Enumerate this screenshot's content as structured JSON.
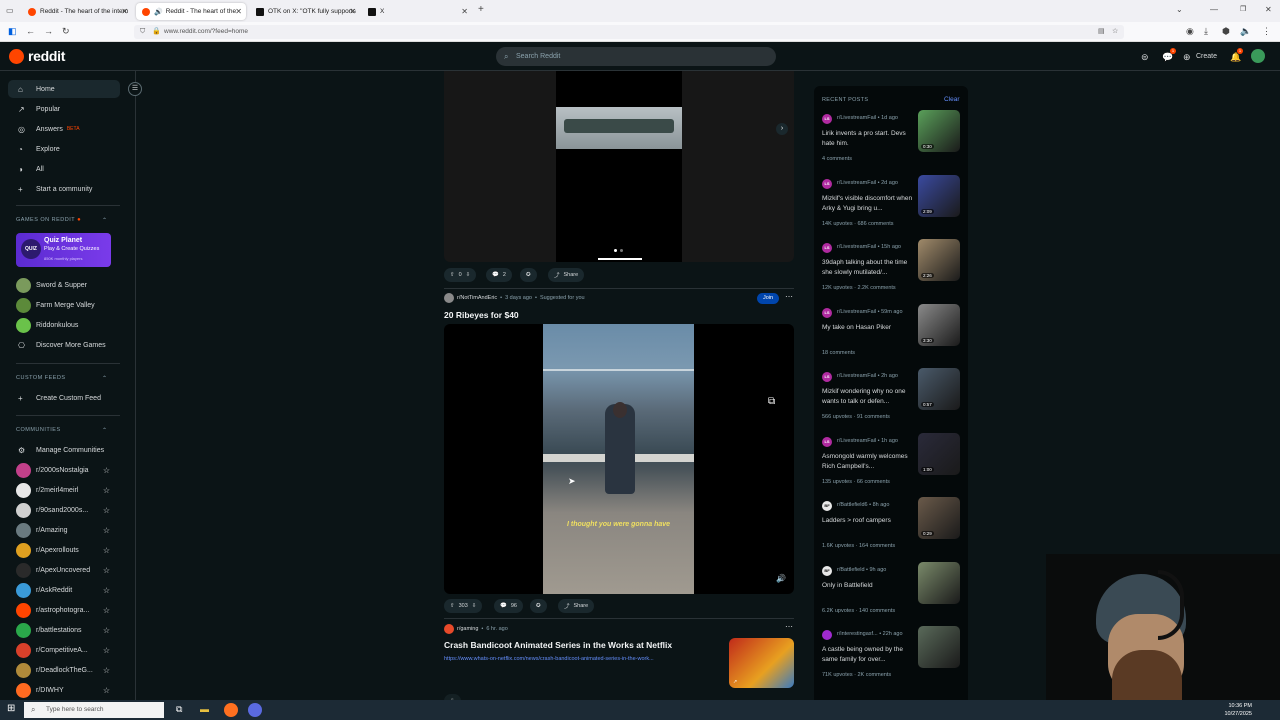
{
  "browser": {
    "tabs": [
      {
        "title": "Reddit - The heart of the intern",
        "color": "#ff4500",
        "active": false
      },
      {
        "title": "Reddit - The heart of the in",
        "color": "#ff4500",
        "active": true
      },
      {
        "title": "OTK on X: \"OTK fully supports a",
        "color": "#111111",
        "active": false
      },
      {
        "title": "X",
        "color": "#111111",
        "active": false
      }
    ],
    "new_tab": "+",
    "url": "www.reddit.com/?feed=home"
  },
  "header": {
    "logo": "reddit",
    "search_placeholder": "Search Reddit",
    "create_label": "Create",
    "chat_badge": "1",
    "notif_badge": "1"
  },
  "sidebar": {
    "nav": [
      {
        "label": "Home",
        "icon": "home-icon",
        "glyph": "⌂",
        "active": true
      },
      {
        "label": "Popular",
        "icon": "popular-icon",
        "glyph": "↗"
      },
      {
        "label": "Answers",
        "icon": "answers-icon",
        "glyph": "◎",
        "badge": "BETA"
      },
      {
        "label": "Explore",
        "icon": "explore-icon",
        "glyph": "◔"
      },
      {
        "label": "All",
        "icon": "all-icon",
        "glyph": "◑"
      },
      {
        "label": "Start a community",
        "icon": "plus-icon",
        "glyph": "+"
      }
    ],
    "games_header": "GAMES ON REDDIT",
    "quiz": {
      "title": "Quiz Planet",
      "subtitle": "Play & Create Quizzes",
      "players": "850K monthly players",
      "logo": "QUIZ"
    },
    "games": [
      {
        "label": "Sword & Supper",
        "color": "#7a9a5c"
      },
      {
        "label": "Farm Merge Valley",
        "color": "#5c8a3a"
      },
      {
        "label": "Riddonkulous",
        "color": "#6ac24a"
      },
      {
        "label": "Discover More Games",
        "color": "#3a4a50"
      }
    ],
    "custom_feeds_header": "CUSTOM FEEDS",
    "create_custom_feed": "Create Custom Feed",
    "communities_header": "COMMUNITIES",
    "manage_communities": "Manage Communities",
    "communities": [
      {
        "label": "r/2000sNostalgia",
        "color": "#c2408a"
      },
      {
        "label": "r/2meirl4meirl",
        "color": "#e8e8e8"
      },
      {
        "label": "r/90sand2000s...",
        "color": "#d0d0d0"
      },
      {
        "label": "r/Amazing",
        "color": "#6a7a80"
      },
      {
        "label": "r/Apexrollouts",
        "color": "#e0a020"
      },
      {
        "label": "r/ApexUncovered",
        "color": "#2a2a2a"
      },
      {
        "label": "r/AskReddit",
        "color": "#3a9ad8"
      },
      {
        "label": "r/astrophotogra...",
        "color": "#ff4500"
      },
      {
        "label": "r/battlestations",
        "color": "#2aa84a"
      },
      {
        "label": "r/CompetitiveA...",
        "color": "#d8402a"
      },
      {
        "label": "r/DeadlockTheG...",
        "color": "#b08a3a"
      },
      {
        "label": "r/DIWHY",
        "color": "#ff6a20"
      }
    ]
  },
  "feed": {
    "post1": {
      "votes": "0",
      "comments": "2",
      "share": "Share"
    },
    "post2": {
      "subreddit": "r/NotTimAndEric",
      "time": "3 days ago",
      "suggested": "Suggested for you",
      "join": "Join",
      "title": "20 Ribeyes for $40",
      "caption": "I thought you were gonna have",
      "votes": "303",
      "comments": "96",
      "share": "Share"
    },
    "post3": {
      "subreddit": "r/gaming",
      "time": "6 hr. ago",
      "title": "Crash Bandicoot Animated Series in the Works at Netflix",
      "link": "https://www.whats-on-netflix.com/news/crash-bandicoot-animated-series-in-the-work..."
    }
  },
  "recent": {
    "header": "RECENT POSTS",
    "clear": "Clear",
    "posts": [
      {
        "sub": "r/LivestreamFail",
        "time": "1d ago",
        "title": "Lirik invents a pro start. Devs hate him.",
        "stats": "4 comments",
        "avatar": "LS",
        "avcolor": "#b02aa0",
        "duration": "0:30",
        "thumb": "#5aa05a"
      },
      {
        "sub": "r/LivestreamFail",
        "time": "2d ago",
        "title": "Mizkif's visible discomfort when Arky & Yugi bring u...",
        "stats": "14K upvotes · 686 comments",
        "avatar": "LS",
        "avcolor": "#b02aa0",
        "duration": "2:09",
        "thumb": "#3a4aa0"
      },
      {
        "sub": "r/LivestreamFail",
        "time": "15h ago",
        "title": "39daph talking about the time she slowly mutilated/...",
        "stats": "12K upvotes · 2.2K comments",
        "avatar": "LS",
        "avcolor": "#b02aa0",
        "duration": "2:26",
        "thumb": "#a08a6a"
      },
      {
        "sub": "r/LivestreamFail",
        "time": "59m ago",
        "title": "My take on Hasan Piker",
        "stats": "18 comments",
        "avatar": "LS",
        "avcolor": "#b02aa0",
        "duration": "3:30",
        "thumb": "#8a8a8a"
      },
      {
        "sub": "r/LivestreamFail",
        "time": "2h ago",
        "title": "Mizkif wondering why no one wants to talk or defen...",
        "stats": "566 upvotes · 91 comments",
        "avatar": "LS",
        "avcolor": "#b02aa0",
        "duration": "0:57",
        "thumb": "#4a5a6a"
      },
      {
        "sub": "r/LivestreamFail",
        "time": "1h ago",
        "title": "Asmongold warmly welcomes Rich Campbell's...",
        "stats": "135 upvotes · 66 comments",
        "avatar": "LS",
        "avcolor": "#b02aa0",
        "duration": "1:00",
        "thumb": "#2a2a3a"
      },
      {
        "sub": "r/Battlefield6",
        "time": "8h ago",
        "title": "Ladders > roof campers",
        "stats": "1.6K upvotes · 164 comments",
        "avatar": "BF",
        "avcolor": "#e8e8e8",
        "duration": "0:29",
        "thumb": "#6a5a4a"
      },
      {
        "sub": "r/Battlefield",
        "time": "9h ago",
        "title": "Only in Battlefield",
        "stats": "6.2K upvotes · 140 comments",
        "avatar": "BF",
        "avcolor": "#e8e8e8",
        "duration": "",
        "thumb": "#7a8a6a"
      },
      {
        "sub": "r/interestingasf...",
        "time": "22h ago",
        "title": "A castle being owned by the same family for over...",
        "stats": "71K upvotes · 2K comments",
        "avatar": "",
        "avcolor": "#a02ad0",
        "duration": "",
        "thumb": "#5a6a5a"
      }
    ]
  },
  "taskbar": {
    "search_placeholder": "Type here to search",
    "time": "10:36 PM",
    "date": "10/27/2025"
  }
}
